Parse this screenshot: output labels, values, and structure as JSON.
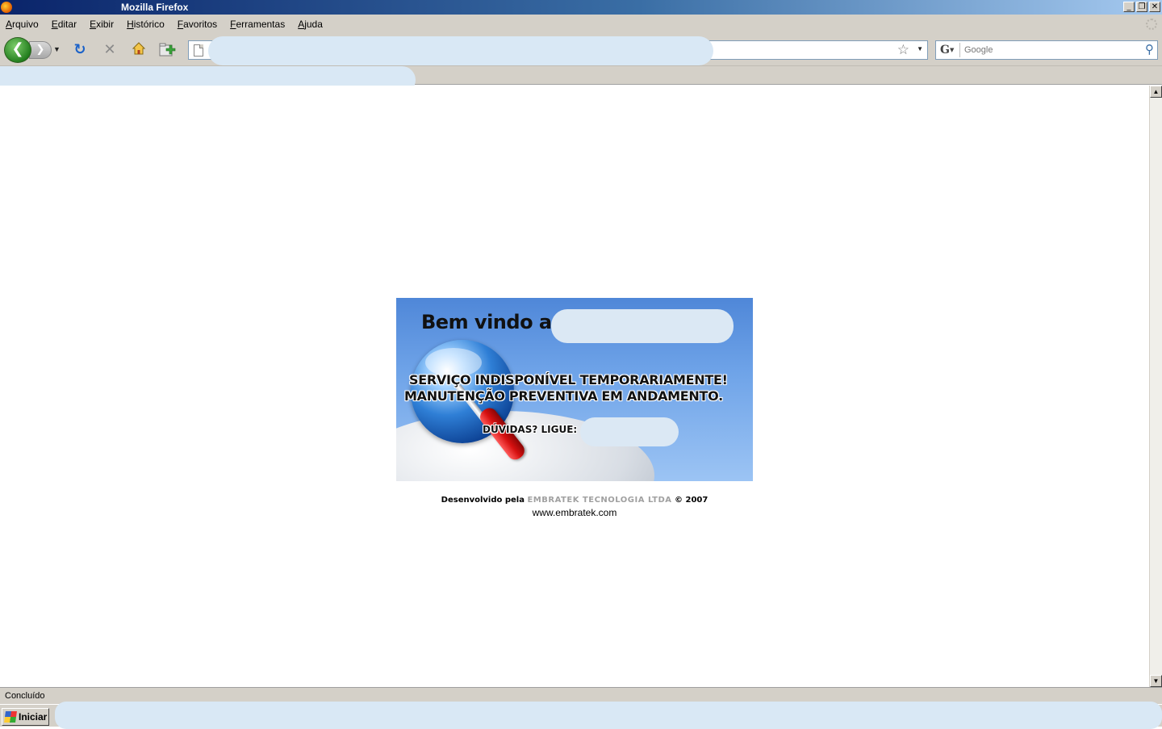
{
  "window": {
    "title": "Mozilla Firefox"
  },
  "menu": {
    "items": [
      "Arquivo",
      "Editar",
      "Exibir",
      "Histórico",
      "Favoritos",
      "Ferramentas",
      "Ajuda"
    ]
  },
  "toolbar": {
    "back_glyph": "❮",
    "forward_glyph": "❯",
    "reload_glyph": "↻",
    "stop_glyph": "✕",
    "home_glyph": "⌂",
    "add_glyph": "✚"
  },
  "search": {
    "placeholder": "Google",
    "engine_letter": "G"
  },
  "page": {
    "welcome": "Bem vindo a",
    "line1": "SERVIÇO INDISPONÍVEL TEMPORARIAMENTE!",
    "line2": "MANUTENÇÃO PREVENTIVA EM ANDAMENTO.",
    "phone_label": "DÚVIDAS? LIGUE:",
    "credits_prefix": "Desenvolvido pela",
    "credits_company": "EMBRATEK TECNOLOGIA LTDA",
    "credits_suffix": "© 2007",
    "website": "www.embratek.com"
  },
  "status": {
    "text": "Concluído"
  },
  "taskbar": {
    "start_label": "Iniciar"
  },
  "colors": {
    "titlebar_start": "#0a246a",
    "chrome": "#d4d0c8",
    "banner_blue": "#4f87d8",
    "redaction": "#d9e8f5"
  }
}
